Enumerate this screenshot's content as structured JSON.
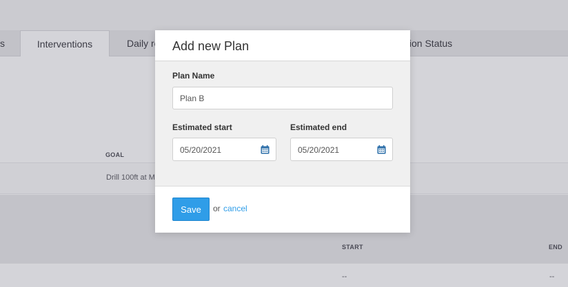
{
  "background": {
    "tabs": [
      {
        "label": "s"
      },
      {
        "label": "Interventions"
      },
      {
        "label": "Daily re"
      },
      {
        "label": "tion Status"
      }
    ],
    "table1": {
      "goal_header": "GOAL",
      "goal_value": "Drill 100ft at M"
    },
    "table2": {
      "start_header": "START",
      "end_header": "END",
      "start_value": "--",
      "end_value": "--"
    }
  },
  "modal": {
    "title": "Add new Plan",
    "plan_name_label": "Plan Name",
    "plan_name_value": "Plan B",
    "estimated_start_label": "Estimated start",
    "estimated_start_value": "05/20/2021",
    "estimated_end_label": "Estimated end",
    "estimated_end_value": "05/20/2021",
    "save_label": "Save",
    "or_text": "or",
    "cancel_label": "cancel"
  },
  "colors": {
    "accent": "#2f9de8",
    "icon": "#2b6ea8"
  },
  "icons": {
    "date_picker": "calendar-icon"
  }
}
